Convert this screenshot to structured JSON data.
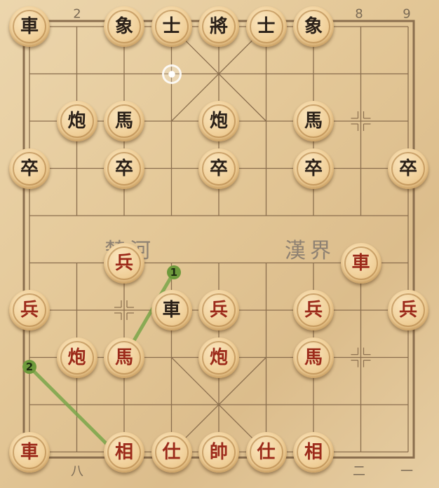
{
  "board": {
    "top_coords": [
      "2",
      "8",
      "9"
    ],
    "bottom_coords": [
      "八",
      "二",
      "一"
    ],
    "river_left": "楚河",
    "river_right": "漢界",
    "colors": {
      "line": "#8a6e4e",
      "red_text": "#9c2a1a",
      "black_text": "#2a2018",
      "hint_line": "#7aa64a"
    }
  },
  "pieces": [
    {
      "side": "black",
      "label": "車",
      "col": 0,
      "row": 0
    },
    {
      "side": "black",
      "label": "象",
      "col": 2,
      "row": 0
    },
    {
      "side": "black",
      "label": "士",
      "col": 3,
      "row": 0
    },
    {
      "side": "black",
      "label": "將",
      "col": 4,
      "row": 0
    },
    {
      "side": "black",
      "label": "士",
      "col": 5,
      "row": 0
    },
    {
      "side": "black",
      "label": "象",
      "col": 6,
      "row": 0
    },
    {
      "side": "black",
      "label": "炮",
      "col": 1,
      "row": 2
    },
    {
      "side": "black",
      "label": "馬",
      "col": 2,
      "row": 2
    },
    {
      "side": "black",
      "label": "炮",
      "col": 4,
      "row": 2
    },
    {
      "side": "black",
      "label": "馬",
      "col": 6,
      "row": 2
    },
    {
      "side": "black",
      "label": "卒",
      "col": 0,
      "row": 3
    },
    {
      "side": "black",
      "label": "卒",
      "col": 2,
      "row": 3
    },
    {
      "side": "black",
      "label": "卒",
      "col": 4,
      "row": 3
    },
    {
      "side": "black",
      "label": "卒",
      "col": 6,
      "row": 3
    },
    {
      "side": "black",
      "label": "卒",
      "col": 8,
      "row": 3
    },
    {
      "side": "red",
      "label": "兵",
      "col": 2,
      "row": 5
    },
    {
      "side": "red",
      "label": "車",
      "col": 7,
      "row": 5
    },
    {
      "side": "red",
      "label": "兵",
      "col": 0,
      "row": 6
    },
    {
      "side": "black",
      "label": "車",
      "col": 3,
      "row": 6
    },
    {
      "side": "red",
      "label": "兵",
      "col": 4,
      "row": 6
    },
    {
      "side": "red",
      "label": "兵",
      "col": 6,
      "row": 6
    },
    {
      "side": "red",
      "label": "兵",
      "col": 8,
      "row": 6
    },
    {
      "side": "red",
      "label": "炮",
      "col": 1,
      "row": 7
    },
    {
      "side": "red",
      "label": "馬",
      "col": 2,
      "row": 7
    },
    {
      "side": "red",
      "label": "炮",
      "col": 4,
      "row": 7
    },
    {
      "side": "red",
      "label": "馬",
      "col": 6,
      "row": 7
    },
    {
      "side": "red",
      "label": "車",
      "col": 0,
      "row": 9
    },
    {
      "side": "red",
      "label": "相",
      "col": 2,
      "row": 9
    },
    {
      "side": "red",
      "label": "仕",
      "col": 3,
      "row": 9
    },
    {
      "side": "red",
      "label": "帥",
      "col": 4,
      "row": 9
    },
    {
      "side": "red",
      "label": "仕",
      "col": 5,
      "row": 9
    },
    {
      "side": "red",
      "label": "相",
      "col": 6,
      "row": 9
    }
  ],
  "hints": [
    {
      "label": "1",
      "from": {
        "col": 2,
        "row": 7
      },
      "to": {
        "col": 3.05,
        "row": 5.2
      }
    },
    {
      "label": "2",
      "from": {
        "col": 2,
        "row": 9.2
      },
      "to": {
        "col": 0,
        "row": 7.2
      }
    }
  ],
  "target_marker": {
    "col": 3,
    "row": 1
  }
}
